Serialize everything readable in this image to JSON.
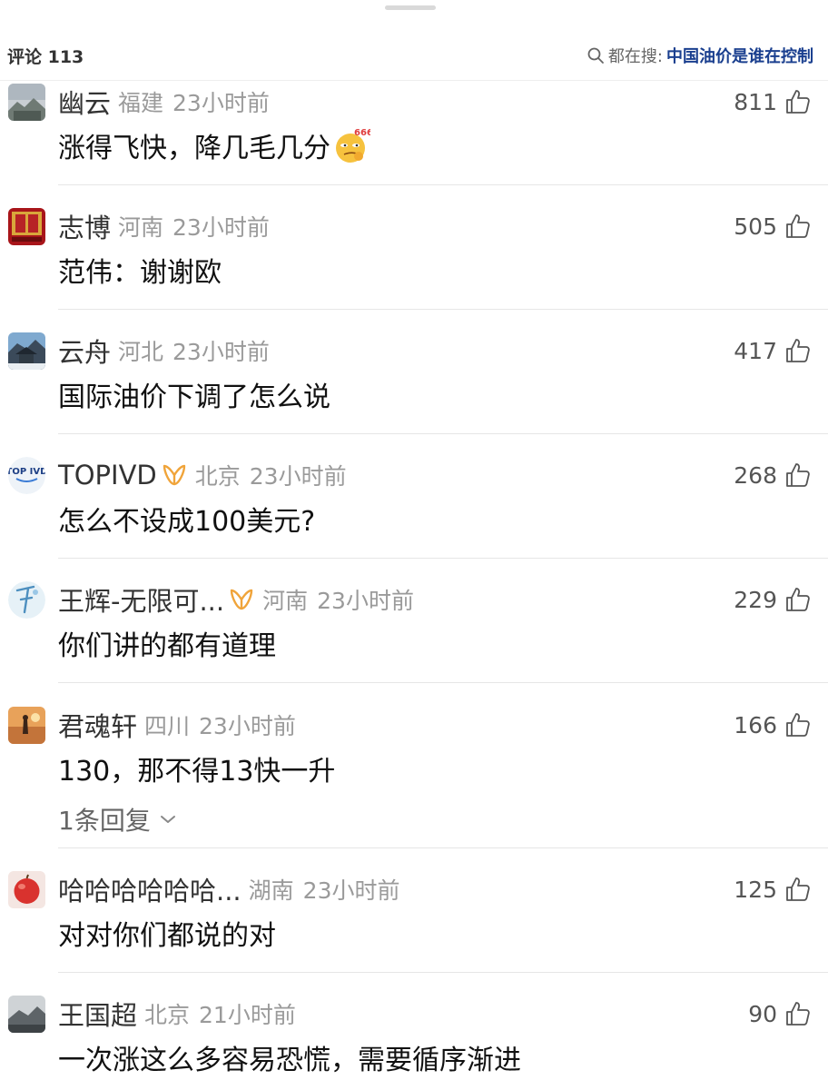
{
  "header": {
    "comments_label": "评论 113",
    "search_prefix": "都在搜:",
    "search_keyword": "中国油价是谁在控制"
  },
  "comments": [
    {
      "user": "幽云",
      "region": "福建",
      "time": "23小时前",
      "likes": "811",
      "text": "涨得飞快，降几毛几分",
      "emoji": "666-smirk-emoji"
    },
    {
      "user": "志博",
      "region": "河南",
      "time": "23小时前",
      "likes": "505",
      "text": "范伟：谢谢欧"
    },
    {
      "user": "云舟",
      "region": "河北",
      "time": "23小时前",
      "likes": "417",
      "text": "国际油价下调了怎么说"
    },
    {
      "user": "TOPIVD",
      "vip": true,
      "region": "北京",
      "time": "23小时前",
      "likes": "268",
      "text": "怎么不设成100美元?"
    },
    {
      "user": "王辉-无限可...",
      "vip": true,
      "region": "河南",
      "time": "23小时前",
      "likes": "229",
      "text": "你们讲的都有道理"
    },
    {
      "user": "君魂轩",
      "region": "四川",
      "time": "23小时前",
      "likes": "166",
      "text": "130，那不得13快一升",
      "replies": "1条回复"
    },
    {
      "user": "哈哈哈哈哈哈...",
      "region": "湖南",
      "time": "23小时前",
      "likes": "125",
      "text": "对对你们都说的对"
    },
    {
      "user": "王国超",
      "region": "北京",
      "time": "21小时前",
      "likes": "90",
      "text": "一次涨这么多容易恐慌，需要循序渐进"
    }
  ],
  "avatar_text": {
    "topivd": "TOP IVD"
  },
  "colors": {
    "keyword": "#1a3f8f",
    "vip_badge": "#f0a43a",
    "meta_gray": "#9a9a9a"
  }
}
